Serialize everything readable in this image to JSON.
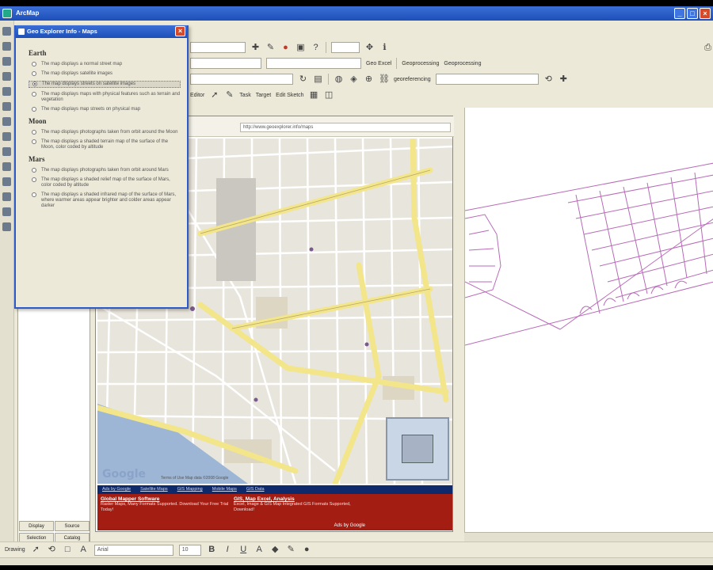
{
  "window": {
    "title": "ArcMap"
  },
  "toolbar": {
    "row1": {
      "layer_combo": "",
      "scale_combo": ""
    },
    "row2": {
      "combo_a": "",
      "combo_b": "",
      "geo_label": "Geo Excel",
      "combo_c": "Geoprocessing",
      "btn_label": "Geoprocessing"
    },
    "row3": {
      "combo_a": "",
      "georef_label": "georeferencing"
    },
    "row4": {
      "editor_label": "Editor",
      "task_label": "Task",
      "target_label": "Target",
      "subtask_label": "Edit Sketch"
    }
  },
  "dialog": {
    "title": "Geo Explorer Info - Maps",
    "groups": [
      {
        "name": "Earth",
        "options": [
          {
            "text": "The map displays a normal street map",
            "selected": false
          },
          {
            "text": "The map displays satellite images",
            "selected": false
          },
          {
            "text": "The map displays streets on satellite images",
            "selected": true
          },
          {
            "text": "The map displays maps with physical features such as terrain and vegetation",
            "selected": false
          },
          {
            "text": "The map displays map streets on physical map",
            "selected": false
          }
        ]
      },
      {
        "name": "Moon",
        "options": [
          {
            "text": "The map displays photographs taken from orbit around the Moon",
            "selected": false
          },
          {
            "text": "The map displays a shaded terrain map of the surface of the Moon, color coded by altitude",
            "selected": false
          }
        ]
      },
      {
        "name": "Mars",
        "options": [
          {
            "text": "The map displays photographs taken from orbit around Mars",
            "selected": false
          },
          {
            "text": "The map displays a shaded relief map of the surface of Mars, color coded by altitude",
            "selected": false
          },
          {
            "text": "The map displays a shaded infrared map of the surface of Mars, where warmer areas appear brighter and colder areas appear darker",
            "selected": false
          }
        ]
      }
    ]
  },
  "map": {
    "address": "http://www.geoexplorer.info/maps",
    "google_label": "Google",
    "copyright": "Terms of Use  Map data ©2008 Google",
    "ad_links": [
      "Ads by Google",
      "Satellite Maps",
      "GIS Mapping",
      "Mobile Maps",
      "GIS Data"
    ],
    "ads": [
      {
        "title": "Global Mapper Software",
        "desc": "Raster Maps, Many Formats Supported. Download Your Free Trial Today!"
      },
      {
        "title": "GIS, Map Excel, Analysis",
        "desc": "Excel, Image & GIS Map Integrated GIS Formats Supported, Download!"
      }
    ],
    "ads_by": "Ads by Google"
  },
  "toc_tabs": [
    "Display",
    "Source",
    "Selection",
    "Catalog"
  ],
  "drawing": {
    "drawing_label": "Drawing",
    "font_combo": "Arial",
    "size_combo": "10"
  },
  "colors": {
    "titlebar": "#1d4fb8",
    "parcel_line": "#b86ab8",
    "road_major": "#f2e58a",
    "ad_bg": "#a31d12",
    "water": "#9db6d6"
  }
}
